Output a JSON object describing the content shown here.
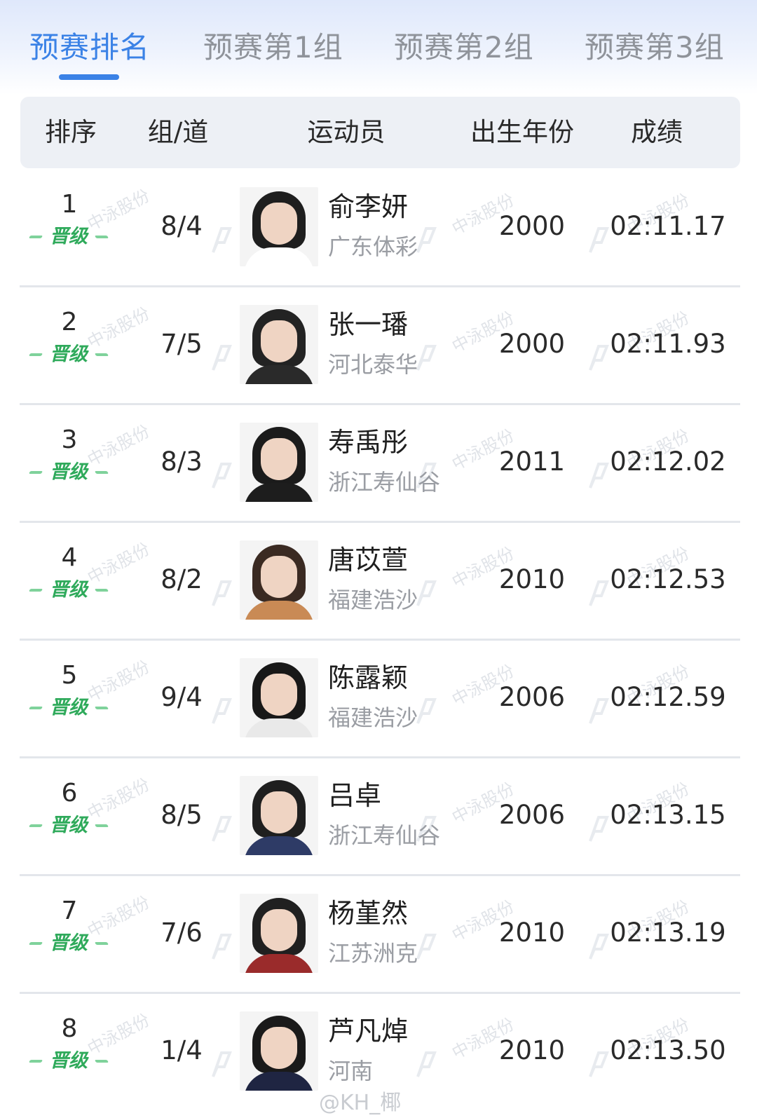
{
  "tabs": [
    {
      "label": "预赛排名",
      "active": true
    },
    {
      "label": "预赛第1组",
      "active": false
    },
    {
      "label": "预赛第2组",
      "active": false
    },
    {
      "label": "预赛第3组",
      "active": false
    }
  ],
  "columns": [
    "排序",
    "组/道",
    "运动员",
    "出生年份",
    "成绩"
  ],
  "qualified_badge": "晋级",
  "watermark": "中泳股份",
  "rows": [
    {
      "rank": "1",
      "lane": "8/4",
      "name": "俞李妍",
      "team": "广东体彩",
      "year": "2000",
      "time": "02:11.17"
    },
    {
      "rank": "2",
      "lane": "7/5",
      "name": "张一璠",
      "team": "河北泰华",
      "year": "2000",
      "time": "02:11.93"
    },
    {
      "rank": "3",
      "lane": "8/3",
      "name": "寿禹彤",
      "team": "浙江寿仙谷",
      "year": "2011",
      "time": "02:12.02"
    },
    {
      "rank": "4",
      "lane": "8/2",
      "name": "唐苡萱",
      "team": "福建浩沙",
      "year": "2010",
      "time": "02:12.53"
    },
    {
      "rank": "5",
      "lane": "9/4",
      "name": "陈露颖",
      "team": "福建浩沙",
      "year": "2006",
      "time": "02:12.59"
    },
    {
      "rank": "6",
      "lane": "8/5",
      "name": "吕卓",
      "team": "浙江寿仙谷",
      "year": "2006",
      "time": "02:13.15"
    },
    {
      "rank": "7",
      "lane": "7/6",
      "name": "杨堇然",
      "team": "江苏洲克",
      "year": "2010",
      "time": "02:13.19"
    },
    {
      "rank": "8",
      "lane": "1/4",
      "name": "芦凡焯",
      "team": "河南",
      "year": "2010",
      "time": "02:13.50"
    }
  ],
  "credit": "@KH_椰",
  "colors": {
    "accent": "#3b82e6",
    "badge_green": "#2faa5b",
    "header_bg": "#edf0f5"
  }
}
